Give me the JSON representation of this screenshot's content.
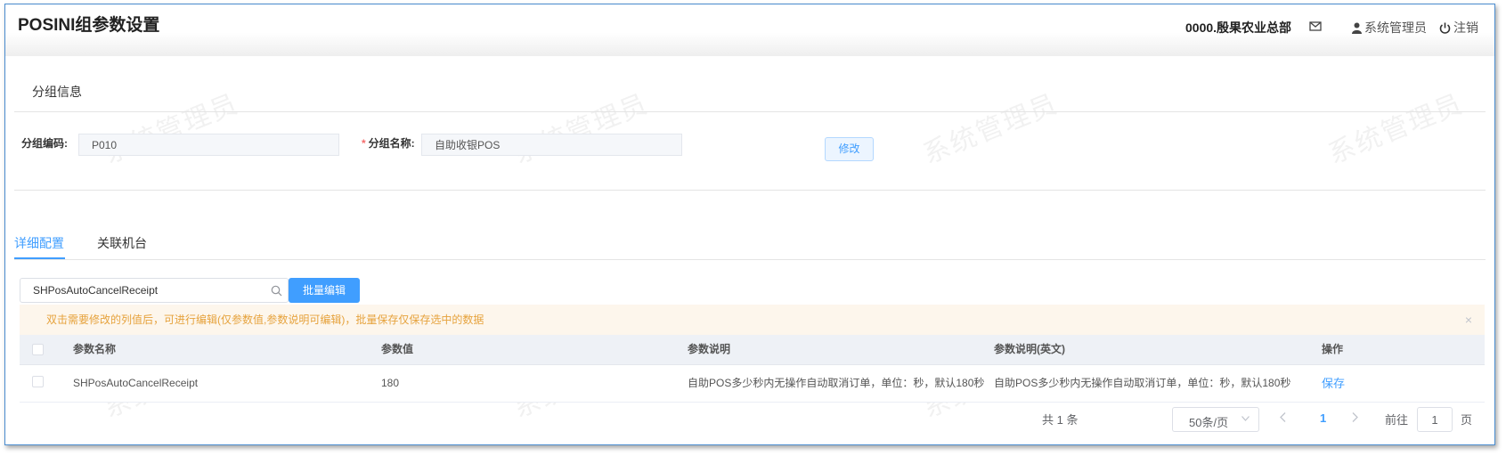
{
  "header": {
    "title": "POSINI组参数设置",
    "org": "0000.殷果农业总部",
    "user": "系统管理员",
    "logout": "注销"
  },
  "watermark": "系统管理员",
  "group_info": {
    "section_title": "分组信息",
    "code_label": "分组编码:",
    "code_value": "P010",
    "name_required_mark": "*",
    "name_label": "分组名称:",
    "name_value": "自助收银POS",
    "edit_button": "修改"
  },
  "tabs": [
    {
      "label": "详细配置",
      "active": true
    },
    {
      "label": "关联机台",
      "active": false
    }
  ],
  "toolbar": {
    "search_value": "SHPosAutoCancelReceipt",
    "batch_edit": "批量编辑"
  },
  "alert": {
    "text": "双击需要修改的列值后，可进行编辑(仅参数值,参数说明可编辑)，批量保存仅保存选中的数据",
    "close": "×"
  },
  "table": {
    "columns": [
      "参数名称",
      "参数值",
      "参数说明",
      "参数说明(英文)",
      "操作"
    ],
    "rows": [
      {
        "name": "SHPosAutoCancelReceipt",
        "value": "180",
        "desc": "自助POS多少秒内无操作自动取消订单，单位：秒，默认180秒",
        "desc_en": "自助POS多少秒内无操作自动取消订单，单位：秒，默认180秒",
        "action": "保存"
      }
    ]
  },
  "pagination": {
    "total": "共 1 条",
    "page_size": "50条/页",
    "current_page": "1",
    "goto_label": "前往",
    "goto_value": "1",
    "page_unit": "页"
  },
  "colors": {
    "primary": "#409eff",
    "warning_bg": "#fdf6ec",
    "warning_text": "#e6a23c",
    "frame_border": "#4a8ccf"
  }
}
